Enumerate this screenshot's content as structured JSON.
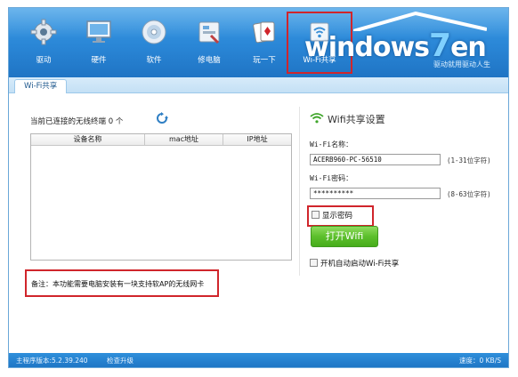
{
  "toolbar": {
    "items": [
      {
        "label": "驱动",
        "icon": "gear-icon"
      },
      {
        "label": "硬件",
        "icon": "monitor-icon"
      },
      {
        "label": "软件",
        "icon": "disc-icon"
      },
      {
        "label": "修电脑",
        "icon": "repair-tools-icon"
      },
      {
        "label": "玩一下",
        "icon": "cards-icon"
      },
      {
        "label": "Wi-Fi共享",
        "icon": "wifi-share-icon"
      }
    ],
    "active_index": 5
  },
  "brand": {
    "watermark_prefix": "windows",
    "watermark_seven": "7",
    "watermark_suffix": "en",
    "slogan": "驱动就用驱动人生"
  },
  "tabs": [
    {
      "label": "Wi-Fi共享"
    }
  ],
  "devices": {
    "title": "当前已连接的无线终端 0 个",
    "refresh_icon": "refresh-icon",
    "columns": [
      "设备名称",
      "mac地址",
      "IP地址"
    ],
    "rows": []
  },
  "note": "备注：本功能需要电脑安装有一块支持软AP的无线网卡",
  "wifi_settings": {
    "title": "Wifi共享设置",
    "name_label": "Wi-Fi名称：",
    "name_value": "ACERB960-PC-56510",
    "name_hint": "(1-31位字符)",
    "password_label": "Wi-Fi密码：",
    "password_value": "**********",
    "password_hint": "(8-63位字符)",
    "show_password_label": "显示密码",
    "open_button": "打开Wifi",
    "autostart_label": "开机自动启动Wi-Fi共享"
  },
  "status": {
    "version": "主程序版本:5.2.39.240",
    "update": "检查升级",
    "speed": "速度：0 KB/S"
  },
  "colors": {
    "header_blue": "#2a86d6",
    "highlight_red": "#d0252b",
    "button_green": "#5cbf2c"
  }
}
